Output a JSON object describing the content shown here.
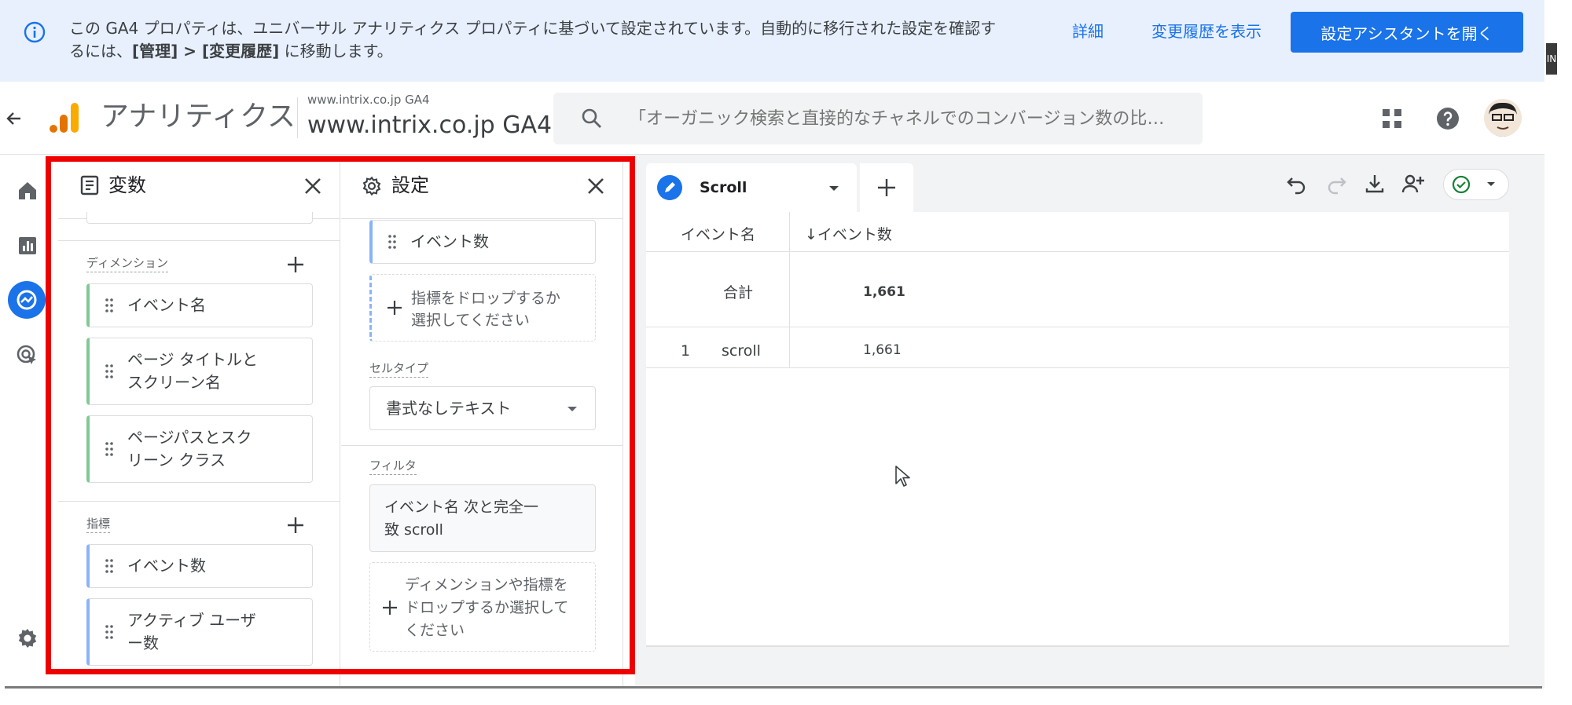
{
  "banner": {
    "text_line1": "この GA4 プロパティは、ユニバーサル アナリティクス プロパティに基づいて設定されています。自動的に移行された設定を確認す",
    "text_line2_pre": "るには、",
    "text_line2_bold": "[管理] > [変更履歴]",
    "text_line2_post": " に移動します。",
    "link_details": "詳細",
    "link_history": "変更履歴を表示",
    "button_assistant": "設定アシスタントを開く",
    "right_edge_text": "IN"
  },
  "header": {
    "app_name": "アナリティクス",
    "property_small": "www.intrix.co.jp GA4",
    "property_big": "www.intrix.co.jp GA4",
    "search_placeholder": "「オーガニック検索と直接的なチャネルでのコンバージョン数の比…"
  },
  "variables_panel": {
    "title": "変数",
    "dimensions_label": "ディメンション",
    "dimensions": [
      {
        "label": "イベント名"
      },
      {
        "label": "ページ タイトルと\nスクリーン名"
      },
      {
        "label": "ページパスとスク\nリーン クラス"
      }
    ],
    "metrics_label": "指標",
    "metrics": [
      {
        "label": "イベント数"
      },
      {
        "label": "アクティブ ユーザ\nー数"
      }
    ]
  },
  "settings_panel": {
    "title": "設定",
    "value_chip": "イベント数",
    "drop_metric": "指標をドロップするか\n選択してください",
    "cell_type_label": "セルタイプ",
    "cell_type_value": "書式なしテキスト",
    "filter_label": "フィルタ",
    "filter_chip": "イベント名 次と完全一\n致 scroll",
    "drop_filter": "ディメンションや指標を\nドロップするか選択して\nください"
  },
  "canvas": {
    "tab_name": "Scroll",
    "table": {
      "col_dimension": "イベント名",
      "col_metric": "↓イベント数",
      "total_label": "合計",
      "total_value": "1,661",
      "rows": [
        {
          "index": "1",
          "name": "scroll",
          "value": "1,661"
        }
      ]
    }
  },
  "colors": {
    "accent": "#1a73e8",
    "banner_bg": "#e8f0fe",
    "highlight": "#ee0000",
    "dimension_chip": "#81c995",
    "metric_chip": "#8ab4f8"
  }
}
